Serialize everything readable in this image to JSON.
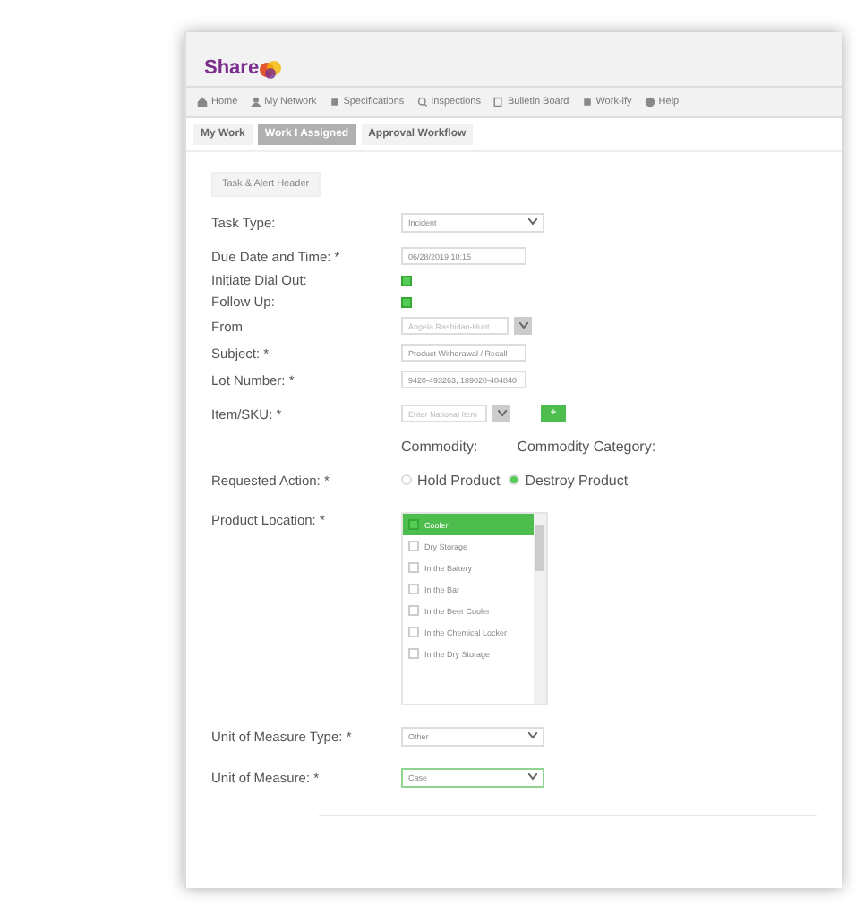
{
  "logo": {
    "text": "Share"
  },
  "nav": [
    {
      "label": "Home"
    },
    {
      "label": "My Network"
    },
    {
      "label": "Specifications"
    },
    {
      "label": "Inspections"
    },
    {
      "label": "Bulletin Board"
    },
    {
      "label": "Work-ify"
    },
    {
      "label": "Help"
    }
  ],
  "tabs": [
    {
      "label": "My Work",
      "selected": false
    },
    {
      "label": "Work I Assigned",
      "selected": true
    },
    {
      "label": "Approval Workflow",
      "selected": false
    }
  ],
  "section": {
    "legend": "Task & Alert Header"
  },
  "fields": [
    {
      "kind": "select",
      "label": "Task Type:",
      "value": "Incident"
    },
    {
      "kind": "text",
      "label": "Due Date and Time: *",
      "value": "06/28/2019 10:15"
    },
    {
      "kind": "checkbox",
      "label": "Initiate Dial Out:",
      "checked": true
    },
    {
      "kind": "checkbox",
      "label": "Follow Up:",
      "checked": true
    },
    {
      "kind": "lookup",
      "label": "From",
      "placeholder": "Angela Rashidan-Hunt"
    },
    {
      "kind": "text",
      "label": "Subject: *",
      "value": "Product Withdrawal / Recall"
    },
    {
      "kind": "text",
      "label": "Lot Number: *",
      "value": "9420-493263, 189020-404840"
    },
    {
      "kind": "item",
      "label": "Item/SKU: *",
      "placeholder": "Enter National Item",
      "add": "+"
    },
    {
      "kind": "commodity",
      "labels": [
        "Commodity:",
        "Commodity Category:"
      ]
    },
    {
      "kind": "radio",
      "label": "Requested Action: *",
      "options": [
        {
          "label": "Hold Product",
          "selected": false
        },
        {
          "label": "Destroy Product",
          "selected": true
        }
      ]
    },
    {
      "kind": "list",
      "label": "Product Location: *",
      "items": [
        {
          "label": "Cooler",
          "checked": true
        },
        {
          "label": "Dry Storage",
          "checked": false
        },
        {
          "label": "In the Bakery",
          "checked": false
        },
        {
          "label": "In the Bar",
          "checked": false
        },
        {
          "label": "In the Beer Cooler",
          "checked": false
        },
        {
          "label": "In the Chemical Locker",
          "checked": false
        },
        {
          "label": "In the Dry Storage",
          "checked": false
        }
      ]
    },
    {
      "kind": "select",
      "label": "Unit of Measure Type: *",
      "value": "Other"
    },
    {
      "kind": "select",
      "label": "Unit of Measure: *",
      "value": "Case",
      "focused": true
    }
  ]
}
